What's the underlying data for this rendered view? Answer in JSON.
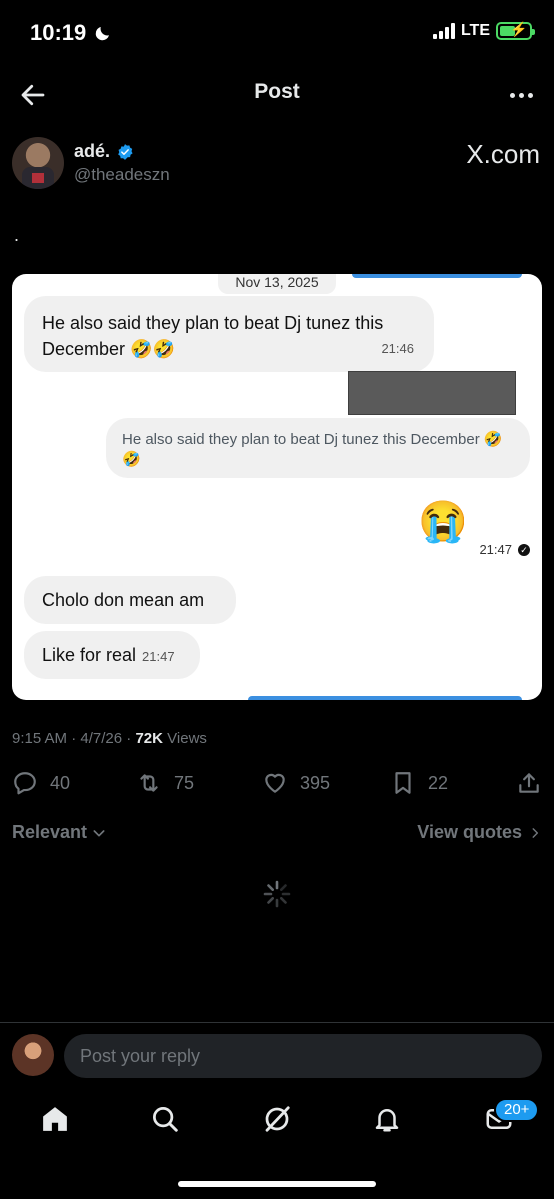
{
  "status_bar": {
    "time": "10:19",
    "network": "LTE",
    "battery_percent": 55
  },
  "topbar": {
    "title": "Post"
  },
  "author": {
    "name": "adé.",
    "handle": "@theadeszn",
    "source": "X.com"
  },
  "post": {
    "text": "."
  },
  "screenshot": {
    "date": "Nov 13, 2025",
    "messages": [
      {
        "text": "He also said they plan to beat Dj tunez this December 🤣🤣",
        "time": "21:46"
      },
      {
        "quote": "He also said they plan to beat Dj tunez this December 🤣🤣"
      },
      {
        "emoji": "😭",
        "time": "21:47"
      },
      {
        "text": "Cholo don mean am"
      },
      {
        "text": "Like for real",
        "time": "21:47"
      }
    ]
  },
  "meta": {
    "time": "9:15 AM",
    "date": "4/7/26",
    "views_count": "72K",
    "views_label": "Views"
  },
  "actions": {
    "replies": "40",
    "reposts": "75",
    "likes": "395",
    "bookmarks": "22"
  },
  "filter": {
    "sort_label": "Relevant",
    "view_quotes_label": "View quotes"
  },
  "reply": {
    "placeholder": "Post your reply"
  },
  "tabbar": {
    "messages_badge": "20+"
  },
  "colors": {
    "accent": "#1d9bf0",
    "muted": "#71767b",
    "background": "#000000"
  }
}
